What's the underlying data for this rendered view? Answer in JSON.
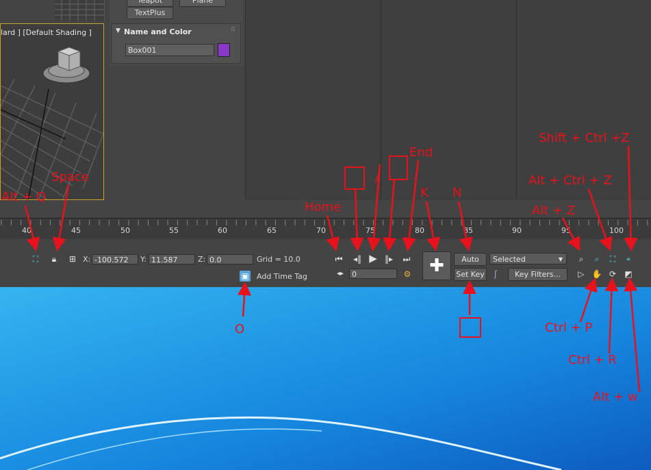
{
  "viewport": {
    "label": "lard ] [Default Shading ]"
  },
  "command_panel": {
    "buttons": [
      "Teapot",
      "Plane",
      "TextPlus"
    ],
    "rollout_title": "Name and Color",
    "object_name": "Box001",
    "object_color": "#8a38c8"
  },
  "timeline": {
    "ticks": [
      "40",
      "45",
      "50",
      "55",
      "60",
      "65",
      "70",
      "75",
      "80",
      "85",
      "90",
      "95",
      "100"
    ]
  },
  "status": {
    "x_label": "X:",
    "x_value": "-100.572",
    "y_label": "Y:",
    "y_value": "11.587",
    "z_label": "Z:",
    "z_value": "0.0",
    "grid": "Grid = 10.0",
    "add_time_tag": "Add Time Tag",
    "frame_value": "0",
    "auto_key": "Auto Key",
    "set_key": "Set Key",
    "key_mode": "Selected",
    "key_filters": "Key Filters..."
  },
  "annotations": {
    "shift_ctrl_z": "Shift + Ctrl +Z",
    "alt_ctrl_z": "Alt + Ctrl + Z",
    "alt_z": "Alt + Z",
    "end": "End",
    "slash": "/",
    "k": "K",
    "n": "N",
    "home": "Home",
    "space": "Space",
    "alt_q": "Alt + Q",
    "o": "O",
    "ctrl_p": "Ctrl + P",
    "ctrl_r": "Ctrl + R",
    "alt_w": "Alt + w"
  },
  "colors": {
    "annotation": "#e8121c",
    "desktop": "#1f8fe0",
    "ui_bg": "#444444",
    "viewport_border": "#c9a227"
  }
}
